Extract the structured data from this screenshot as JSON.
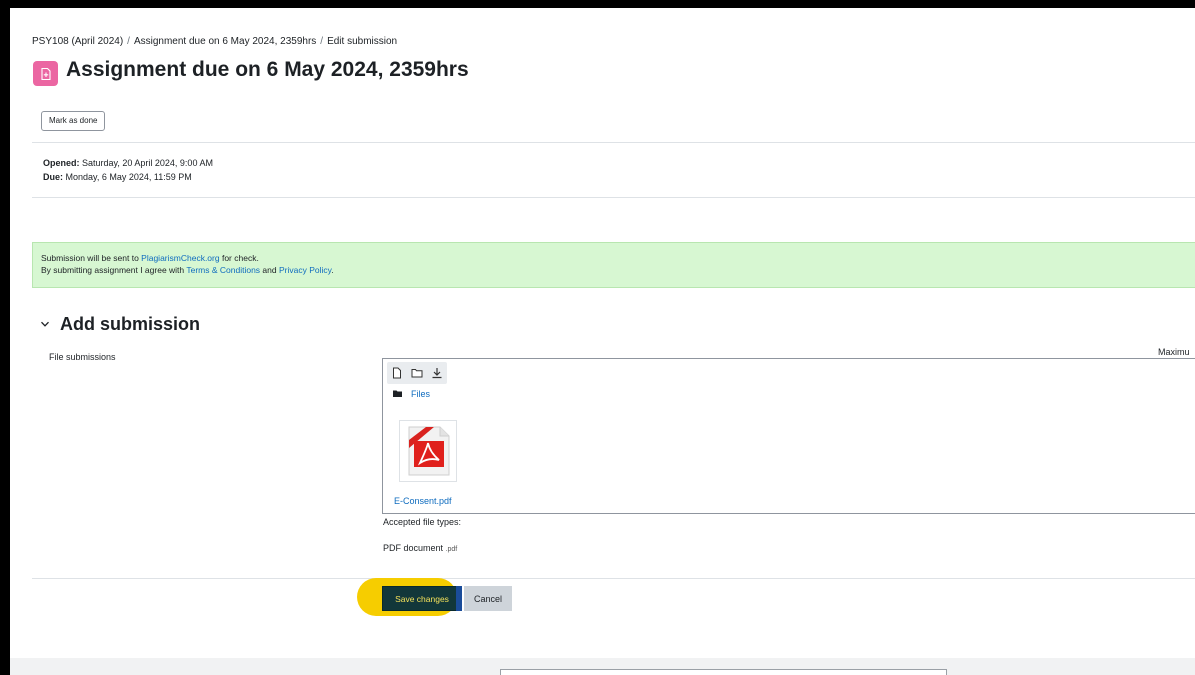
{
  "breadcrumb": {
    "items": [
      "PSY108 (April 2024)",
      "Assignment due on 6 May 2024, 2359hrs",
      "Edit submission"
    ],
    "separator": "/"
  },
  "header": {
    "title": "Assignment due on 6 May 2024, 2359hrs",
    "icon": "assignment-icon",
    "icon_color": "#eb66a2"
  },
  "activity": {
    "mark_done_label": "Mark as done",
    "opened_label": "Opened:",
    "opened_value": "Saturday, 20 April 2024, 9:00 AM",
    "due_label": "Due:",
    "due_value": "Monday, 6 May 2024, 11:59 PM"
  },
  "notice": {
    "line1_pre": "Submission will be sent to ",
    "line1_link": "PlagiarismCheck.org",
    "line1_post": " for check.",
    "line2_pre": "By submitting assignment I agree with ",
    "line2_link1": "Terms & Conditions",
    "line2_mid": " and ",
    "line2_link2": "Privacy Policy",
    "line2_post": ".",
    "background": "#d7f7d2"
  },
  "submission": {
    "section_title": "Add submission",
    "field_label": "File submissions",
    "max_size_label": "Maximu",
    "filemanager": {
      "toolbar_icons": [
        "add-file-icon",
        "create-folder-icon",
        "download-icon"
      ],
      "path_label": "Files",
      "files": [
        {
          "name": "E-Consent.pdf",
          "icon": "pdf-file-icon"
        }
      ]
    },
    "accepted_label": "Accepted file types:",
    "accepted_type": "PDF document",
    "accepted_ext": ".pdf"
  },
  "actions": {
    "save_label": "Save changes",
    "cancel_label": "Cancel",
    "highlight_color": "#f6cd00"
  },
  "colors": {
    "link": "#0f6cbf",
    "save_button_bg": "#12373a",
    "save_button_text": "#f5e25a"
  }
}
